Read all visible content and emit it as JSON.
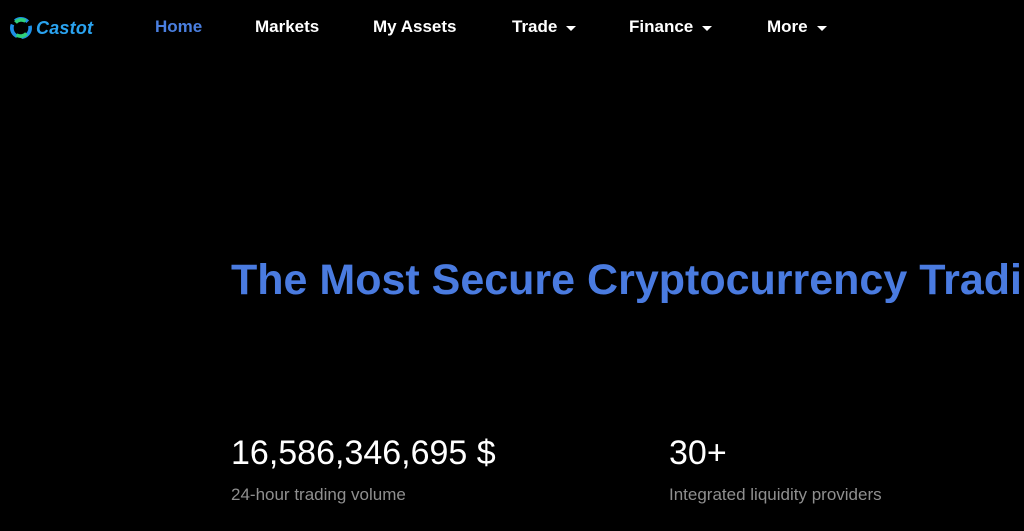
{
  "brand": {
    "name": "Castot",
    "colors": {
      "brand": "#2aa3f0",
      "accent": "#4a7be0",
      "background": "#000000"
    }
  },
  "nav": {
    "items": [
      {
        "label": "Home",
        "active": true,
        "dropdown": false
      },
      {
        "label": "Markets",
        "active": false,
        "dropdown": false
      },
      {
        "label": "My Assets",
        "active": false,
        "dropdown": false
      },
      {
        "label": "Trade",
        "active": false,
        "dropdown": true
      },
      {
        "label": "Finance",
        "active": false,
        "dropdown": true
      },
      {
        "label": "More",
        "active": false,
        "dropdown": true
      }
    ]
  },
  "hero": {
    "title": "The Most Secure Cryptocurrency Trading Platform"
  },
  "stats": [
    {
      "value": "16,586,346,695 $",
      "label": "24-hour trading volume"
    },
    {
      "value": "30+",
      "label": "Integrated liquidity providers"
    }
  ],
  "icons": {
    "logo": "castot-logo-icon",
    "dropdown": "caret-down-icon"
  }
}
